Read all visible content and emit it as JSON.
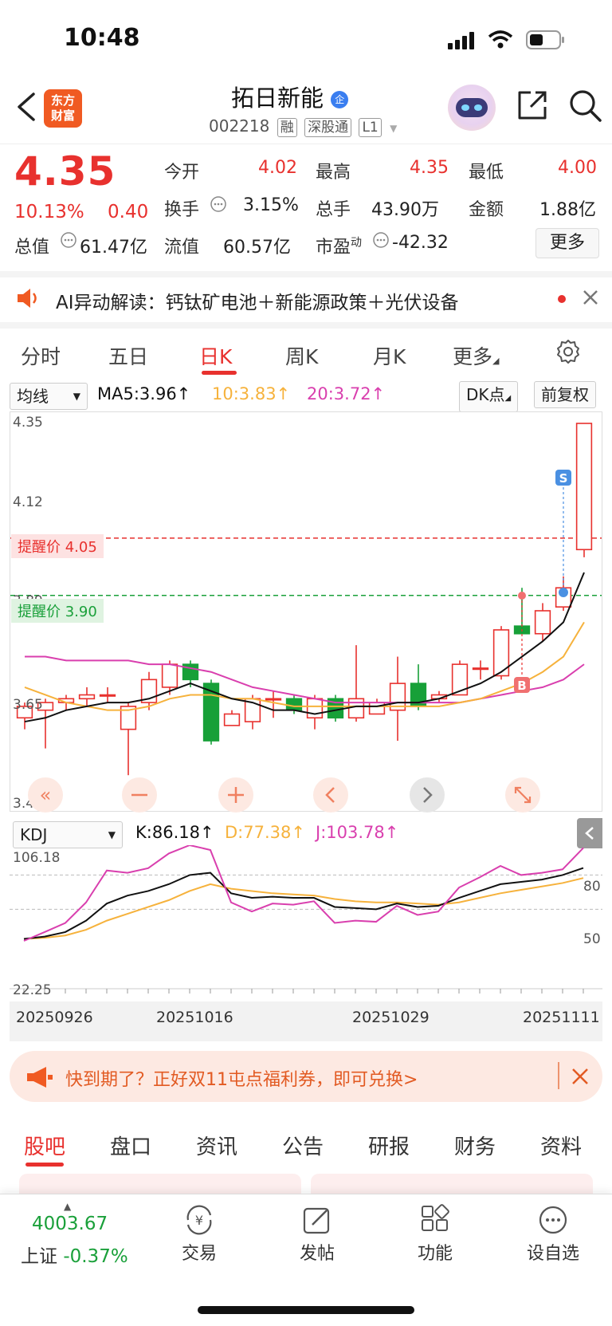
{
  "status": {
    "time": "10:48"
  },
  "header": {
    "logo_line1": "东方",
    "logo_line2": "财富",
    "stock_name": "拓日新能",
    "badge": "企",
    "code": "002218",
    "tags": [
      "融",
      "深股通",
      "L1"
    ]
  },
  "quote": {
    "price": "4.35",
    "change_pct": "10.13%",
    "change_amt": "0.40",
    "open_label": "今开",
    "open": "4.02",
    "high_label": "最高",
    "high": "4.35",
    "low_label": "最低",
    "low": "4.00",
    "turnover_label": "换手",
    "turnover": "3.15%",
    "volume_label": "总手",
    "volume": "43.90万",
    "amount_label": "金额",
    "amount": "1.88亿",
    "mktcap_label": "总值",
    "mktcap": "61.47亿",
    "float_label": "流值",
    "float_cap": "60.57亿",
    "pe_label": "市盈",
    "pe_sup": "动",
    "pe": "-42.32",
    "more": "更多"
  },
  "ai": {
    "text": "AI异动解读：钙钛矿电池＋新能源政策＋光伏设备"
  },
  "tabs": [
    "分时",
    "五日",
    "日K",
    "周K",
    "月K",
    "更多"
  ],
  "indicators": {
    "ma_select": "均线",
    "ma5": "MA5:3.96↑",
    "ma10": "10:3.83↑",
    "ma20": "20:3.72↑",
    "dk": "DK点",
    "adjust": "前复权",
    "kdj_select": "KDJ",
    "k": "K:86.18↑",
    "d": "D:77.38↑",
    "j": "J:103.78↑"
  },
  "chart_labels": {
    "y_max": "4.35",
    "y_412": "4.12",
    "y_389": "3.89",
    "y_365": "3.65",
    "y_min": "3.42",
    "alert_high": "提醒价 4.05",
    "alert_low": "提醒价 3.90",
    "sell": "S",
    "buy": "B",
    "kdj_max": "106.18",
    "kdj_min": "22.25",
    "kdj_80": "80",
    "kdj_50": "50",
    "dates": [
      "20250926",
      "20251016",
      "20251029",
      "20251111"
    ]
  },
  "colors": {
    "up": "#e8312e",
    "down": "#17a038",
    "ma5": "#111111",
    "ma10": "#f6b23c",
    "ma20": "#d93fae",
    "accent": "#f05a22"
  },
  "chart_data": {
    "type": "candlestick",
    "ylim": [
      3.42,
      4.35
    ],
    "alerts": [
      4.05,
      3.9
    ],
    "candles": [
      {
        "o": 3.58,
        "c": 3.61,
        "h": 3.62,
        "l": 3.55
      },
      {
        "o": 3.6,
        "c": 3.62,
        "h": 3.63,
        "l": 3.5
      },
      {
        "o": 3.62,
        "c": 3.63,
        "h": 3.64,
        "l": 3.6
      },
      {
        "o": 3.63,
        "c": 3.64,
        "h": 3.66,
        "l": 3.61
      },
      {
        "o": 3.64,
        "c": 3.64,
        "h": 3.66,
        "l": 3.62
      },
      {
        "o": 3.55,
        "c": 3.61,
        "h": 3.62,
        "l": 3.43
      },
      {
        "o": 3.62,
        "c": 3.68,
        "h": 3.7,
        "l": 3.6
      },
      {
        "o": 3.66,
        "c": 3.72,
        "h": 3.73,
        "l": 3.64
      },
      {
        "o": 3.72,
        "c": 3.68,
        "h": 3.73,
        "l": 3.66
      },
      {
        "o": 3.67,
        "c": 3.52,
        "h": 3.68,
        "l": 3.51
      },
      {
        "o": 3.56,
        "c": 3.59,
        "h": 3.6,
        "l": 3.56
      },
      {
        "o": 3.57,
        "c": 3.63,
        "h": 3.64,
        "l": 3.55
      },
      {
        "o": 3.63,
        "c": 3.63,
        "h": 3.65,
        "l": 3.58
      },
      {
        "o": 3.63,
        "c": 3.6,
        "h": 3.64,
        "l": 3.59
      },
      {
        "o": 3.58,
        "c": 3.63,
        "h": 3.64,
        "l": 3.55
      },
      {
        "o": 3.63,
        "c": 3.58,
        "h": 3.64,
        "l": 3.57
      },
      {
        "o": 3.58,
        "c": 3.63,
        "h": 3.77,
        "l": 3.57
      },
      {
        "o": 3.59,
        "c": 3.62,
        "h": 3.63,
        "l": 3.59
      },
      {
        "o": 3.6,
        "c": 3.67,
        "h": 3.74,
        "l": 3.52
      },
      {
        "o": 3.67,
        "c": 3.61,
        "h": 3.72,
        "l": 3.6
      },
      {
        "o": 3.63,
        "c": 3.64,
        "h": 3.65,
        "l": 3.62
      },
      {
        "o": 3.64,
        "c": 3.72,
        "h": 3.73,
        "l": 3.64
      },
      {
        "o": 3.71,
        "c": 3.71,
        "h": 3.73,
        "l": 3.68
      },
      {
        "o": 3.69,
        "c": 3.81,
        "h": 3.82,
        "l": 3.68
      },
      {
        "o": 3.82,
        "c": 3.8,
        "h": 3.92,
        "l": 3.8
      },
      {
        "o": 3.8,
        "c": 3.86,
        "h": 3.88,
        "l": 3.78
      },
      {
        "o": 3.87,
        "c": 3.92,
        "h": 3.95,
        "l": 3.86
      },
      {
        "o": 4.02,
        "c": 4.35,
        "h": 4.35,
        "l": 4.0
      }
    ],
    "ma5": [
      3.57,
      3.58,
      3.6,
      3.61,
      3.62,
      3.62,
      3.63,
      3.65,
      3.67,
      3.65,
      3.63,
      3.62,
      3.6,
      3.6,
      3.59,
      3.6,
      3.61,
      3.61,
      3.62,
      3.62,
      3.63,
      3.65,
      3.67,
      3.7,
      3.74,
      3.78,
      3.83,
      3.96
    ],
    "ma10": [
      3.66,
      3.64,
      3.62,
      3.61,
      3.6,
      3.6,
      3.61,
      3.63,
      3.64,
      3.64,
      3.63,
      3.63,
      3.62,
      3.61,
      3.61,
      3.61,
      3.61,
      3.61,
      3.61,
      3.61,
      3.61,
      3.62,
      3.63,
      3.65,
      3.67,
      3.7,
      3.74,
      3.83
    ],
    "ma20": [
      3.74,
      3.74,
      3.73,
      3.73,
      3.73,
      3.73,
      3.72,
      3.72,
      3.71,
      3.7,
      3.68,
      3.66,
      3.65,
      3.64,
      3.63,
      3.62,
      3.62,
      3.62,
      3.62,
      3.62,
      3.62,
      3.62,
      3.63,
      3.64,
      3.65,
      3.66,
      3.68,
      3.72
    ],
    "kdj": {
      "ylim": [
        22.25,
        106.18
      ],
      "k": [
        24,
        26,
        30,
        40,
        55,
        62,
        66,
        72,
        80,
        82,
        64,
        60,
        61,
        60,
        60,
        52,
        51,
        50,
        55,
        52,
        53,
        60,
        66,
        72,
        74,
        76,
        80,
        86.18
      ],
      "d": [
        24,
        25,
        27,
        32,
        40,
        46,
        52,
        58,
        66,
        72,
        68,
        66,
        64,
        63,
        62,
        59,
        57,
        56,
        56,
        55,
        54,
        56,
        60,
        64,
        67,
        70,
        73,
        77.38
      ],
      "j": [
        22.25,
        30,
        38,
        56,
        84,
        82,
        86,
        99,
        106.18,
        102,
        56,
        48,
        55,
        54,
        57,
        38,
        40,
        39,
        53,
        45,
        48,
        69,
        78,
        88,
        80,
        82,
        85,
        103.78
      ]
    }
  },
  "promo": {
    "text": "快到期了？正好双11屯点福利券，即可兑换>"
  },
  "bottom_tabs": [
    "股吧",
    "盘口",
    "资讯",
    "公告",
    "研报",
    "财务",
    "资料"
  ],
  "bottom_bar": {
    "index_value": "4003.67",
    "index_name": "上证",
    "index_change": "-0.37%",
    "trade": "交易",
    "post": "发帖",
    "functions": "功能",
    "watchlist": "设自选"
  }
}
